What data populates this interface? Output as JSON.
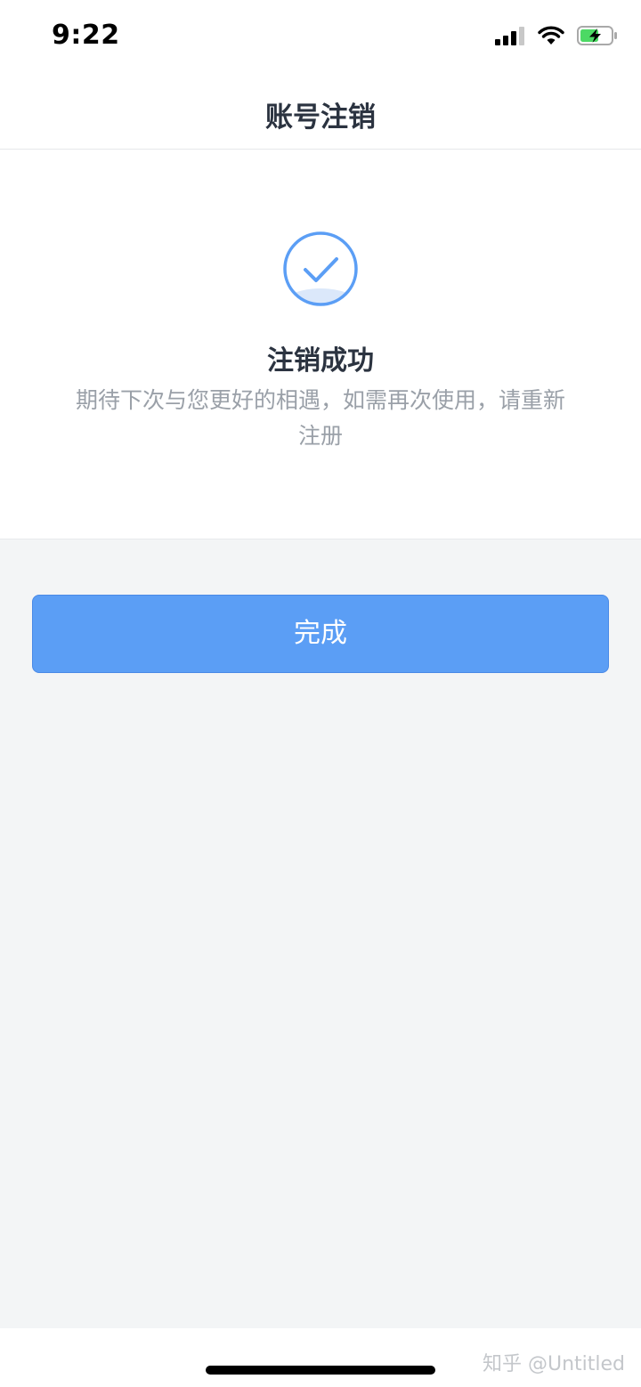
{
  "status_bar": {
    "time": "9:22",
    "icons": [
      "signal-icon",
      "wifi-icon",
      "battery-charging-icon"
    ]
  },
  "nav": {
    "title": "账号注销"
  },
  "result": {
    "icon": "check-circle-icon",
    "title": "注销成功",
    "description": "期待下次与您更好的相遇，如需再次使用，请重新注册"
  },
  "actions": {
    "done_label": "完成"
  },
  "footer": {
    "watermark": "知乎 @Untitled"
  },
  "colors": {
    "accent": "#5b9ef5",
    "title_text": "#2b3340",
    "secondary_text": "#9aa0a8",
    "page_background": "#f3f5f6",
    "battery_green": "#4cd964"
  }
}
